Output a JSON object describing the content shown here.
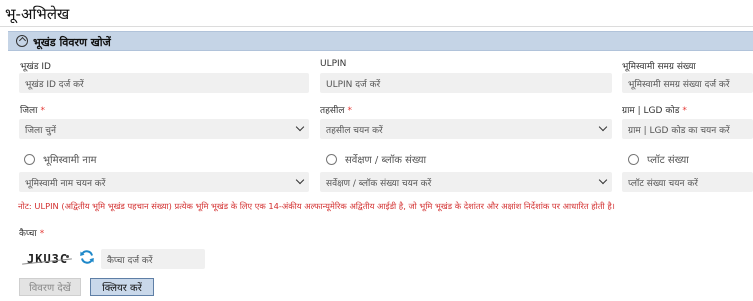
{
  "page": {
    "title": "भू-अभिलेख"
  },
  "panel": {
    "title": "भूखंड विवरण खोजें",
    "toggle_icon": "chevron-up-circle-icon"
  },
  "fields": {
    "bhukhand_id": {
      "label": "भूखंड ID",
      "placeholder": "भूखंड ID दर्ज करें"
    },
    "ulpin": {
      "label": "ULPIN",
      "placeholder": "ULPIN दर्ज करें"
    },
    "bhumiswami_sankhya": {
      "label": "भूमिस्वामी समग्र संख्या",
      "placeholder": "भूमिस्वामी समग्र संख्या दर्ज करें"
    },
    "jila": {
      "label": "जिला",
      "required_mark": "*",
      "placeholder": "जिला चुनें"
    },
    "tehsil": {
      "label": "तहसील",
      "required_mark": "*",
      "placeholder": "तहसील चयन करें"
    },
    "gram": {
      "label": "ग्राम | LGD कोड",
      "required_mark": "*",
      "placeholder": "ग्राम | LGD कोड का चयन करें"
    }
  },
  "radios": {
    "bhumiswami": {
      "label": "भूमिस्वामी नाम",
      "select_placeholder": "भूमिस्वामी नाम चयन करें"
    },
    "survey": {
      "label": "सर्वेक्षण / ब्लॉक संख्या",
      "select_placeholder": "सर्वेक्षण / ब्लॉक संख्या चयन करें"
    },
    "plot": {
      "label": "प्लॉट संख्या",
      "input_placeholder": "प्लॉट संख्या चयन करें"
    }
  },
  "note": "नोट: ULPIN (अद्वितीय भूमि भूखंड पहचान संख्या) प्रत्येक भूमि भूखंड के लिए एक 14-अंकीय अल्फान्यूमेरिक अद्वितीय आईडी है, जो भूमि भूखंड के देशांतर और अक्षांश निर्देशांक पर आधारित होती है।",
  "captcha": {
    "label": "कैप्चा",
    "required_mark": "*",
    "code": "JKU3C",
    "placeholder": "कैप्चा दर्ज करें",
    "refresh_icon": "refresh-icon",
    "accent": "#1e88c9"
  },
  "buttons": {
    "view": "विवरण देखें",
    "clear": "क्लियर करें"
  },
  "colors": {
    "panel_header": "#c5d4e6",
    "required": "#e53935",
    "note": "#d32f2f"
  }
}
